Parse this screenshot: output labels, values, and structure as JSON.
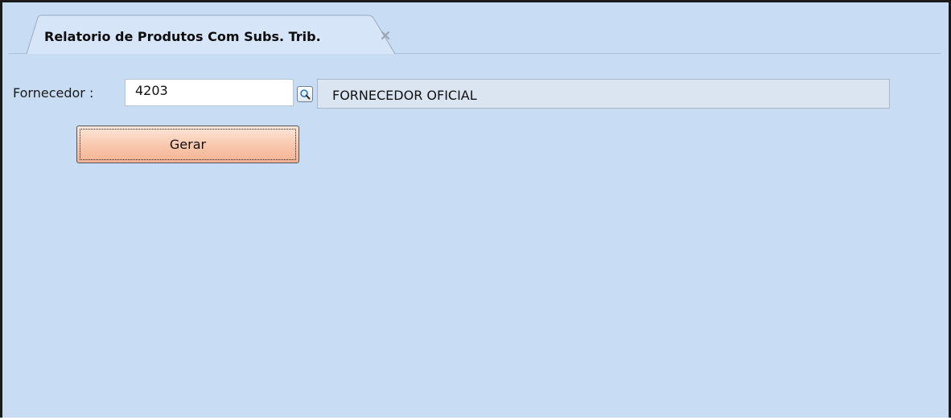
{
  "tab": {
    "title": "Relatorio de Produtos Com Subs. Trib.",
    "close_icon": "close-x-icon"
  },
  "form": {
    "supplier_label": "Fornecedor :",
    "supplier_code": "4203",
    "lookup_icon": "search-magnifier-icon",
    "supplier_name": "FORNECEDOR OFICIAL",
    "generate_label": "Gerar"
  },
  "colors": {
    "background": "#c8dcf4",
    "button_fill": "#f9c7ac",
    "description_box": "#dbe5f1"
  }
}
